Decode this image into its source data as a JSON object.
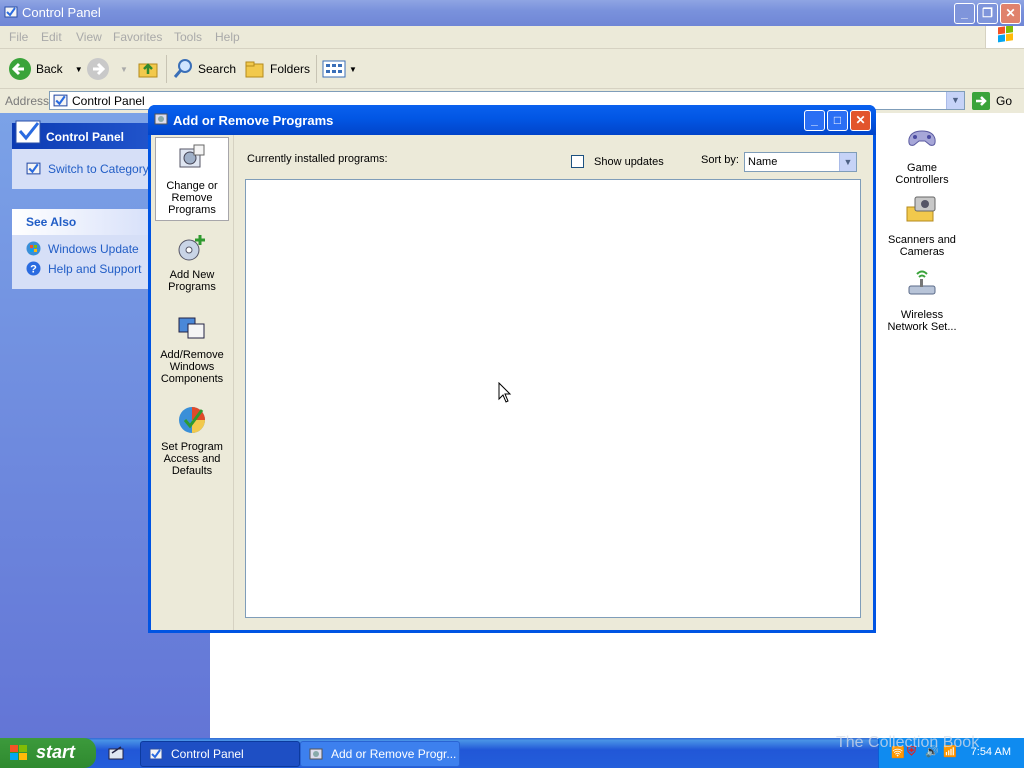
{
  "window": {
    "title": "Control Panel"
  },
  "menu": [
    "File",
    "Edit",
    "View",
    "Favorites",
    "Tools",
    "Help"
  ],
  "toolbar": {
    "back": "Back",
    "search": "Search",
    "folders": "Folders"
  },
  "address": {
    "label": "Address",
    "value": "Control Panel",
    "go": "Go"
  },
  "taskpane": {
    "cp_title": "Control Panel",
    "switch_link": "Switch to Category V",
    "see_also_title": "See Also",
    "links": [
      "Windows Update",
      "Help and Support"
    ]
  },
  "content_icons": [
    {
      "label": "Game Controllers"
    },
    {
      "label": "Scanners and Cameras"
    },
    {
      "label": "Wireless Network Set..."
    }
  ],
  "dialog": {
    "title": "Add or Remove Programs",
    "nav": [
      {
        "label": "Change or Remove Programs"
      },
      {
        "label": "Add New Programs"
      },
      {
        "label": "Add/Remove Windows Components"
      },
      {
        "label": "Set Program Access and Defaults"
      }
    ],
    "installed_label": "Currently installed programs:",
    "show_updates": "Show updates",
    "sort_by_label": "Sort by:",
    "sort_by_value": "Name"
  },
  "taskbar": {
    "start": "start",
    "items": [
      "Control Panel",
      "Add or Remove Progr..."
    ],
    "clock": "7:54 AM"
  },
  "watermark": "The Collection Book"
}
